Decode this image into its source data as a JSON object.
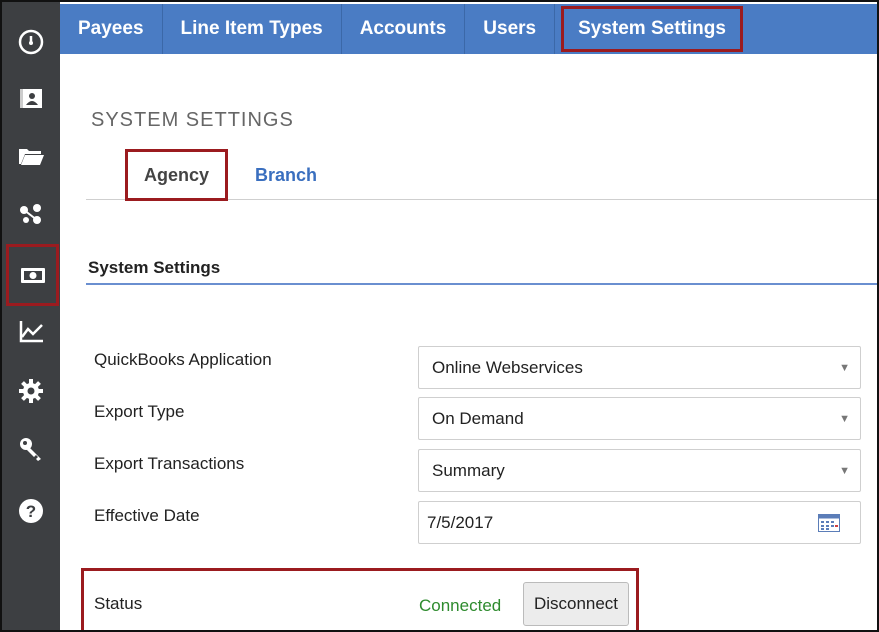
{
  "nav": {
    "tabs": [
      {
        "label": "Payees"
      },
      {
        "label": "Line Item Types"
      },
      {
        "label": "Accounts"
      },
      {
        "label": "Users"
      },
      {
        "label": "System Settings"
      }
    ],
    "active_tab": "System Settings"
  },
  "sidebar": {
    "icons": [
      "dashboard-icon",
      "contact-card-icon",
      "folder-icon",
      "network-icon",
      "money-icon",
      "line-chart-icon",
      "gear-icon",
      "key-icon",
      "help-icon"
    ],
    "active_icon": "money-icon"
  },
  "page": {
    "title": "SYSTEM SETTINGS",
    "subtabs": {
      "agency": "Agency",
      "branch": "Branch"
    },
    "section_title": "System Settings"
  },
  "form": {
    "quickbooks_label": "QuickBooks Application",
    "quickbooks_value": "Online Webservices",
    "export_type_label": "Export Type",
    "export_type_value": "On Demand",
    "export_transactions_label": "Export Transactions",
    "export_transactions_value": "Summary",
    "effective_date_label": "Effective Date",
    "effective_date_value": "7/5/2017",
    "status_label": "Status",
    "status_value": "Connected",
    "disconnect_label": "Disconnect"
  },
  "colors": {
    "nav_blue": "#4a7cc4",
    "rail": "#3d3f42",
    "highlight": "#9b1b1f",
    "connected": "#2e8b2e",
    "link": "#3a6fbf"
  }
}
